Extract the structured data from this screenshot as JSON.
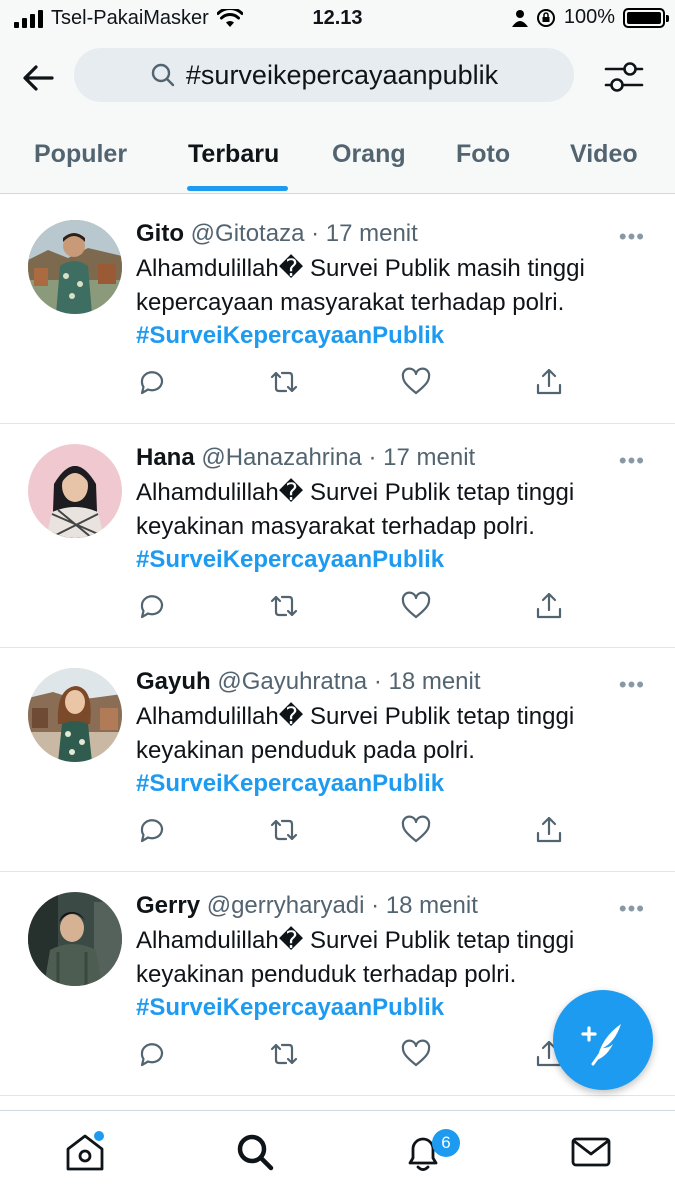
{
  "status_bar": {
    "carrier": "Tsel-PakaiMasker",
    "time": "12.13",
    "battery": "100%"
  },
  "search": {
    "query": "#surveikepercayaanpublik"
  },
  "tabs": [
    {
      "label": "Populer"
    },
    {
      "label": "Terbaru"
    },
    {
      "label": "Orang"
    },
    {
      "label": "Foto"
    },
    {
      "label": "Video"
    }
  ],
  "tweets": [
    {
      "name": "Gito",
      "handle": "@Gitotaza",
      "time": "· 17 menit",
      "text": "Alhamdulillah� Survei Publik masih tinggi kepercayaan masyarakat terhadap polri.",
      "hashtag": "#SurveiKepercayaanPublik"
    },
    {
      "name": "Hana",
      "handle": "@Hanazahrina",
      "time": "· 17 menit",
      "text": "Alhamdulillah� Survei Publik tetap tinggi keyakinan masyarakat terhadap polri.",
      "hashtag": "#SurveiKepercayaanPublik"
    },
    {
      "name": "Gayuh",
      "handle": "@Gayuhratna",
      "time": "· 18 menit",
      "text": "Alhamdulillah� Survei Publik tetap tinggi keyakinan penduduk pada polri.",
      "hashtag": "#SurveiKepercayaanPublik"
    },
    {
      "name": "Gerry",
      "handle": "@gerryharyadi",
      "time": "· 18 menit",
      "text": "Alhamdulillah� Survei Publik tetap tinggi keyakinan penduduk terhadap polri.",
      "hashtag": "#SurveiKepercayaanPublik"
    }
  ],
  "bottom_nav": {
    "notification_count": "6"
  },
  "colors": {
    "accent": "#1d9bf0",
    "text": "#0f1419",
    "muted": "#536471"
  }
}
